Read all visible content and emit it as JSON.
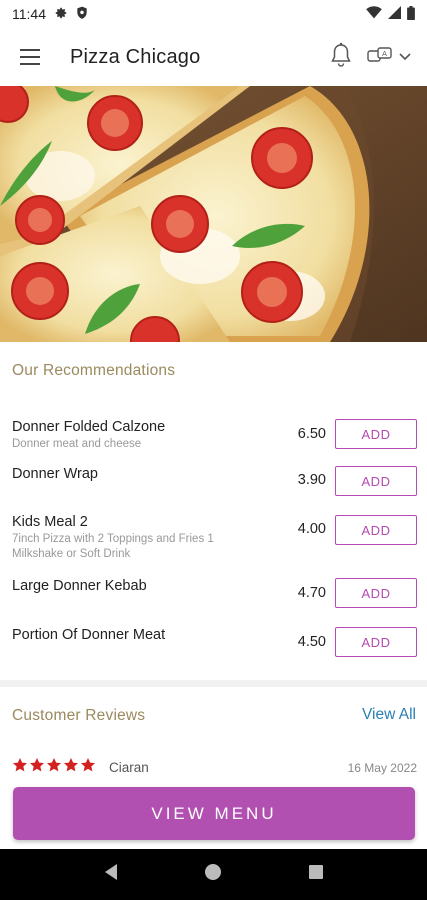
{
  "status_bar": {
    "time": "11:44",
    "icons": [
      "gear-icon",
      "shield-icon",
      "wifi-icon",
      "signal-icon",
      "battery-icon"
    ]
  },
  "app_bar": {
    "title": "Pizza Chicago",
    "icons": [
      "hamburger-menu-icon",
      "bell-icon",
      "language-icon",
      "chevron-down-icon"
    ]
  },
  "hero": {
    "image": "pizza-photo"
  },
  "recommendations": {
    "title": "Our Recommendations",
    "add_label": "ADD",
    "items": [
      {
        "name": "Donner Folded Calzone",
        "desc": "Donner meat and cheese",
        "price": "6.50"
      },
      {
        "name": "Donner Wrap",
        "desc": "",
        "price": "3.90"
      },
      {
        "name": "Kids Meal 2",
        "desc": "7inch Pizza with 2 Toppings and Fries 1 Milkshake or Soft Drink",
        "price": "4.00"
      },
      {
        "name": "Large Donner Kebab",
        "desc": "",
        "price": "4.70"
      },
      {
        "name": "Portion Of Donner Meat",
        "desc": "",
        "price": "4.50"
      }
    ]
  },
  "reviews": {
    "title": "Customer Reviews",
    "view_all": "View All",
    "entries": [
      {
        "rating": 5,
        "author": "Ciaran",
        "date": "16 May 2022"
      }
    ]
  },
  "view_menu_label": "VIEW MENU",
  "nav": {
    "icons": [
      "back-icon",
      "home-icon",
      "recents-icon"
    ]
  },
  "colors": {
    "accent": "#b150b0",
    "section_title": "#9b8a5e",
    "link": "#2a7fb3",
    "star": "#d32020"
  }
}
